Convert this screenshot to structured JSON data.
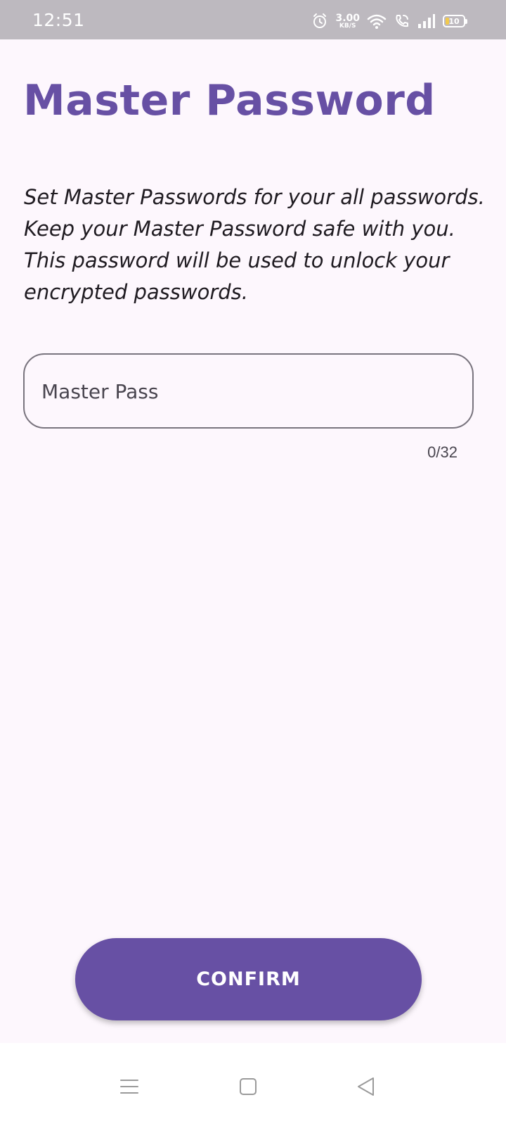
{
  "status_bar": {
    "time": "12:51",
    "net_speed_value": "3.00",
    "net_speed_unit": "KB/S",
    "battery_level": "10",
    "icons": [
      "alarm-icon",
      "wifi-icon",
      "wifi-calling-icon",
      "signal-icon",
      "battery-icon"
    ]
  },
  "screen": {
    "title": "Master Password",
    "description": "Set Master Passwords for your all passwords. Keep your Master Password safe with you. This password will be used to unlock your encrypted passwords.",
    "password_field": {
      "placeholder": "Master Pass",
      "value": "",
      "counter": "0/32"
    },
    "confirm_label": "CONFIRM"
  },
  "nav_bar": {
    "icons": [
      "menu-icon",
      "home-icon",
      "back-icon"
    ]
  },
  "colors": {
    "accent": "#6750a4",
    "background": "#fdf7fd",
    "status_bar": "#bdb9bf"
  }
}
